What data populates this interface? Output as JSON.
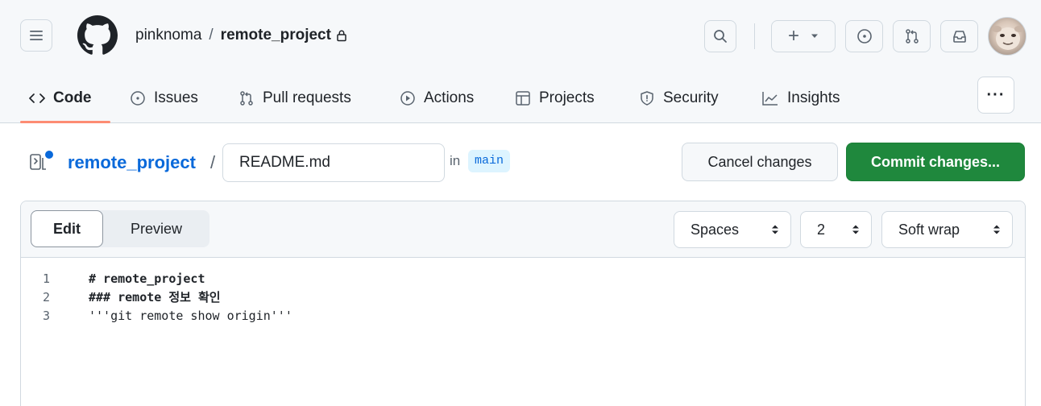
{
  "header": {
    "owner": "pinknoma",
    "separator": "/",
    "repo": "remote_project",
    "plus_label": "+"
  },
  "repo_nav": [
    {
      "label": "Code",
      "icon": "code-icon",
      "active": true
    },
    {
      "label": "Issues",
      "icon": "issue-opened-icon"
    },
    {
      "label": "Pull requests",
      "icon": "git-pull-request-icon"
    },
    {
      "label": "Actions",
      "icon": "play-icon"
    },
    {
      "label": "Projects",
      "icon": "table-icon"
    },
    {
      "label": "Security",
      "icon": "shield-icon"
    },
    {
      "label": "Insights",
      "icon": "graph-icon"
    }
  ],
  "more_label": "···",
  "editor": {
    "breadcrumb_repo": "remote_project",
    "breadcrumb_sep": "/",
    "filename": "README.md",
    "in_label": "in",
    "branch": "main",
    "cancel_label": "Cancel changes",
    "commit_label": "Commit changes..."
  },
  "panel": {
    "tabs": {
      "edit": "Edit",
      "preview": "Preview"
    },
    "indent_mode": "Spaces",
    "indent_size": "2",
    "wrap_mode": "Soft wrap"
  },
  "code_lines": [
    {
      "number": "1",
      "text": "# remote_project",
      "bold": true
    },
    {
      "number": "2",
      "text": "### remote 정보 확인",
      "bold": true
    },
    {
      "number": "3",
      "text": "'''git remote show origin'''",
      "bold": false
    }
  ],
  "colors": {
    "primary_button": "#1f883d",
    "link": "#0969da",
    "active_tab_underline": "#fd8c73",
    "branch_badge_bg": "#ddf4ff"
  }
}
